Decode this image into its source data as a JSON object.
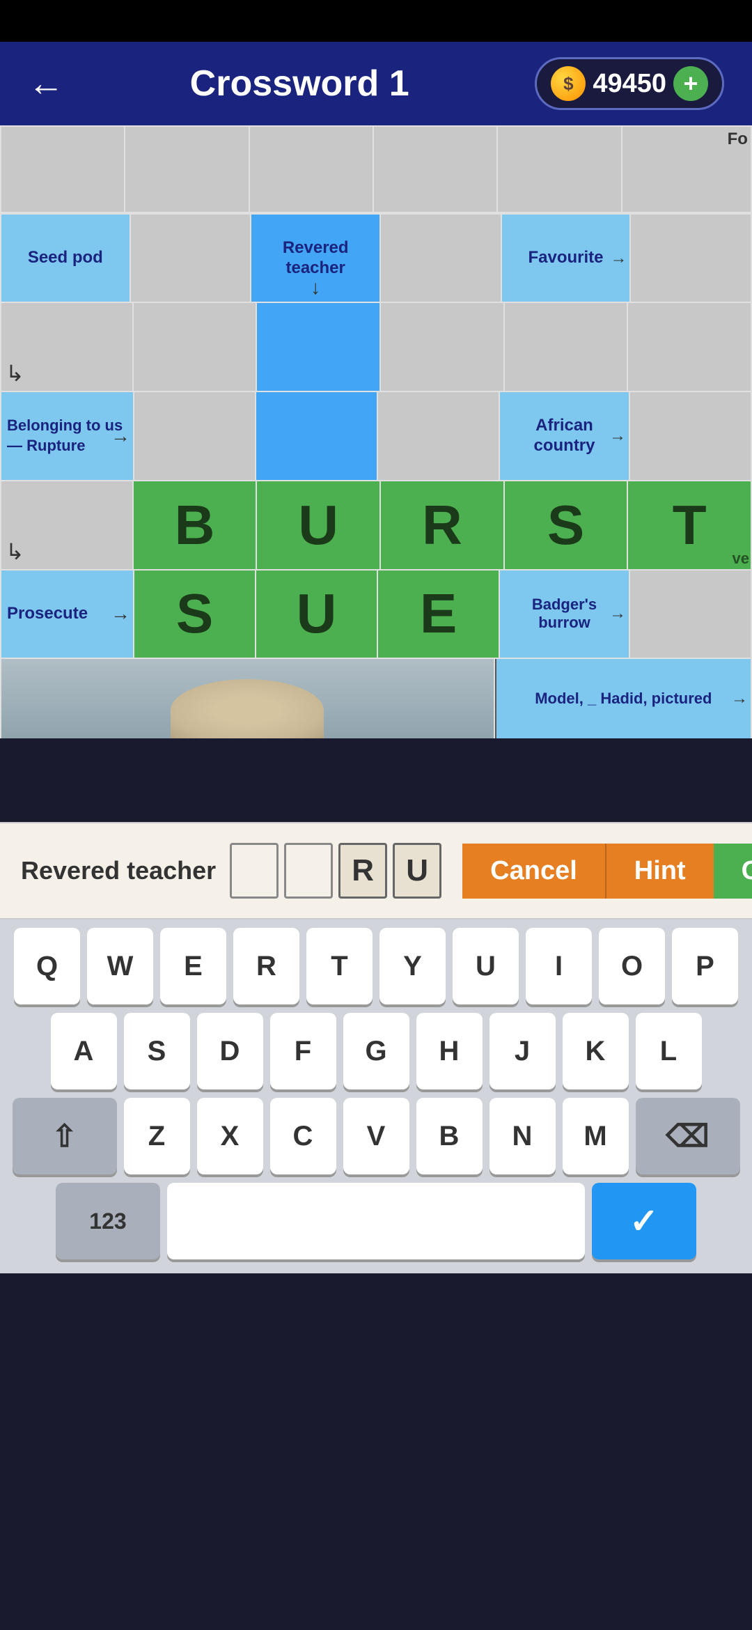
{
  "statusBar": {},
  "header": {
    "title": "Crossword 1",
    "backIcon": "←",
    "coinIcon": "●",
    "coins": "49450",
    "addIcon": "+"
  },
  "grid": {
    "rows": [
      [
        {
          "type": "empty",
          "text": ""
        },
        {
          "type": "empty",
          "text": ""
        },
        {
          "type": "empty",
          "text": ""
        },
        {
          "type": "empty",
          "text": ""
        },
        {
          "type": "empty",
          "text": ""
        },
        {
          "type": "empty",
          "text": "Fo"
        }
      ],
      [
        {
          "type": "blue-light clue",
          "text": "Seed pod",
          "arrow": ""
        },
        {
          "type": "empty",
          "text": ""
        },
        {
          "type": "blue-medium clue",
          "text": "Revered teacher",
          "arrow": "down"
        },
        {
          "type": "empty",
          "text": ""
        },
        {
          "type": "blue-light clue",
          "text": "Favourite",
          "arrow": "right"
        },
        {
          "type": "empty",
          "text": ""
        }
      ],
      [
        {
          "type": "empty arrow-corner",
          "text": ""
        },
        {
          "type": "empty",
          "text": ""
        },
        {
          "type": "blue-medium",
          "text": ""
        },
        {
          "type": "empty",
          "text": ""
        },
        {
          "type": "empty",
          "text": ""
        },
        {
          "type": "empty",
          "text": ""
        }
      ],
      [
        {
          "type": "blue-light clue",
          "text": "Belonging to us — Rupture",
          "arrow": "right"
        },
        {
          "type": "empty",
          "text": ""
        },
        {
          "type": "blue-medium",
          "text": ""
        },
        {
          "type": "empty",
          "text": ""
        },
        {
          "type": "blue-light clue",
          "text": "African country",
          "arrow": "right"
        },
        {
          "type": "empty",
          "text": ""
        }
      ],
      [
        {
          "type": "empty arrow-corner",
          "text": ""
        },
        {
          "type": "green letter",
          "text": "B"
        },
        {
          "type": "green letter",
          "text": "U"
        },
        {
          "type": "green letter",
          "text": "R"
        },
        {
          "type": "green letter",
          "text": "S"
        },
        {
          "type": "green letter partial",
          "text": "T"
        }
      ],
      [
        {
          "type": "blue-light clue",
          "text": "Prosecute",
          "arrow": "right"
        },
        {
          "type": "green letter",
          "text": "S"
        },
        {
          "type": "green letter",
          "text": "U"
        },
        {
          "type": "green letter",
          "text": "E"
        },
        {
          "type": "blue-light clue",
          "text": "Badger's burrow",
          "arrow": "right"
        },
        {
          "type": "empty",
          "text": ""
        }
      ],
      [
        {
          "type": "photo",
          "text": ""
        },
        {
          "type": "photo",
          "text": ""
        },
        {
          "type": "photo",
          "text": ""
        },
        {
          "type": "photo",
          "text": ""
        },
        {
          "type": "blue-light clue",
          "text": "Model, _ Hadid, pictured",
          "arrow": "right"
        },
        {
          "type": "empty",
          "text": ""
        }
      ]
    ]
  },
  "inputBar": {
    "clueText": "Revered teacher",
    "letterBoxes": [
      "",
      "",
      "R",
      "U"
    ],
    "cancelLabel": "Cancel",
    "hintLabel": "Hint",
    "okayLabel": "Okay"
  },
  "keyboard": {
    "rows": [
      [
        "Q",
        "W",
        "E",
        "R",
        "T",
        "Y",
        "U",
        "I",
        "O",
        "P"
      ],
      [
        "A",
        "S",
        "D",
        "F",
        "G",
        "H",
        "J",
        "K",
        "L"
      ],
      [
        "⇧",
        "Z",
        "X",
        "C",
        "V",
        "B",
        "N",
        "M",
        "⌫"
      ]
    ],
    "bottomRow": {
      "numbersLabel": "123",
      "spaceLabel": "",
      "confirmIcon": "✓"
    }
  }
}
